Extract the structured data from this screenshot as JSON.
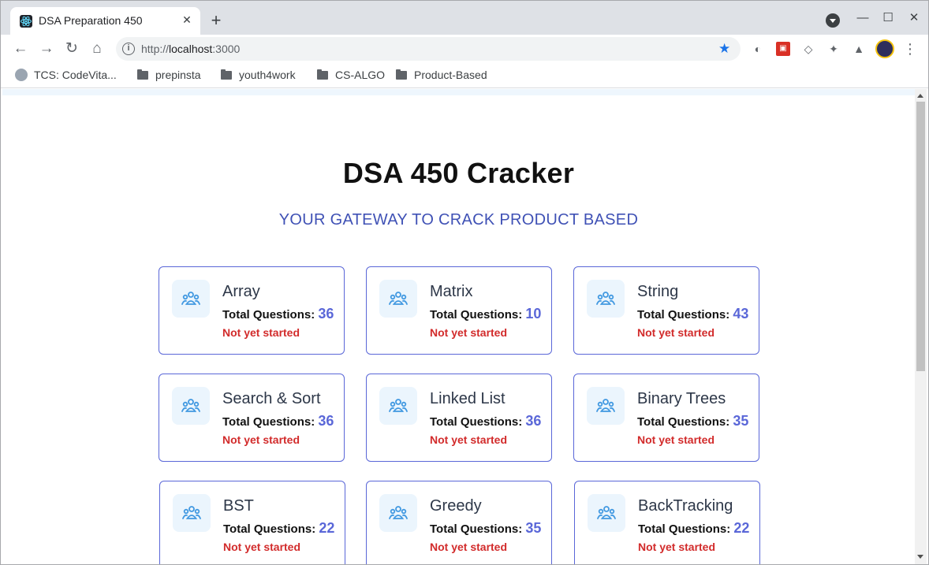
{
  "browser": {
    "tab_title": "DSA Preparation 450",
    "tab_close": "✕",
    "new_tab": "+",
    "url_prefix": "http://",
    "url_host": "localhost",
    "url_suffix": ":3000",
    "bookmarks": [
      {
        "label": "TCS: CodeVita...",
        "type": "site"
      },
      {
        "label": "prepinsta",
        "type": "folder"
      },
      {
        "label": "youth4work",
        "type": "folder"
      },
      {
        "label": "CS-ALGO",
        "type": "folder"
      },
      {
        "label": "Product-Based",
        "type": "folder"
      }
    ]
  },
  "page": {
    "title": "DSA 450 Cracker",
    "subtitle": "YOUR GATEWAY TO CRACK PRODUCT BASED",
    "total_label": "Total Questions:",
    "cards": [
      {
        "name": "Array",
        "total": "36",
        "status": "Not yet started"
      },
      {
        "name": "Matrix",
        "total": "10",
        "status": "Not yet started"
      },
      {
        "name": "String",
        "total": "43",
        "status": "Not yet started"
      },
      {
        "name": "Search & Sort",
        "total": "36",
        "status": "Not yet started"
      },
      {
        "name": "Linked List",
        "total": "36",
        "status": "Not yet started"
      },
      {
        "name": "Binary Trees",
        "total": "35",
        "status": "Not yet started"
      },
      {
        "name": "BST",
        "total": "22",
        "status": "Not yet started"
      },
      {
        "name": "Greedy",
        "total": "35",
        "status": "Not yet started"
      },
      {
        "name": "BackTracking",
        "total": "22",
        "status": "Not yet started"
      }
    ]
  },
  "colors": {
    "accent": "#5a67d8",
    "subtitle": "#3f51b5",
    "status_red": "#d22b2b",
    "icon_bg": "#ebf5fd",
    "icon_fg": "#4299e1"
  }
}
